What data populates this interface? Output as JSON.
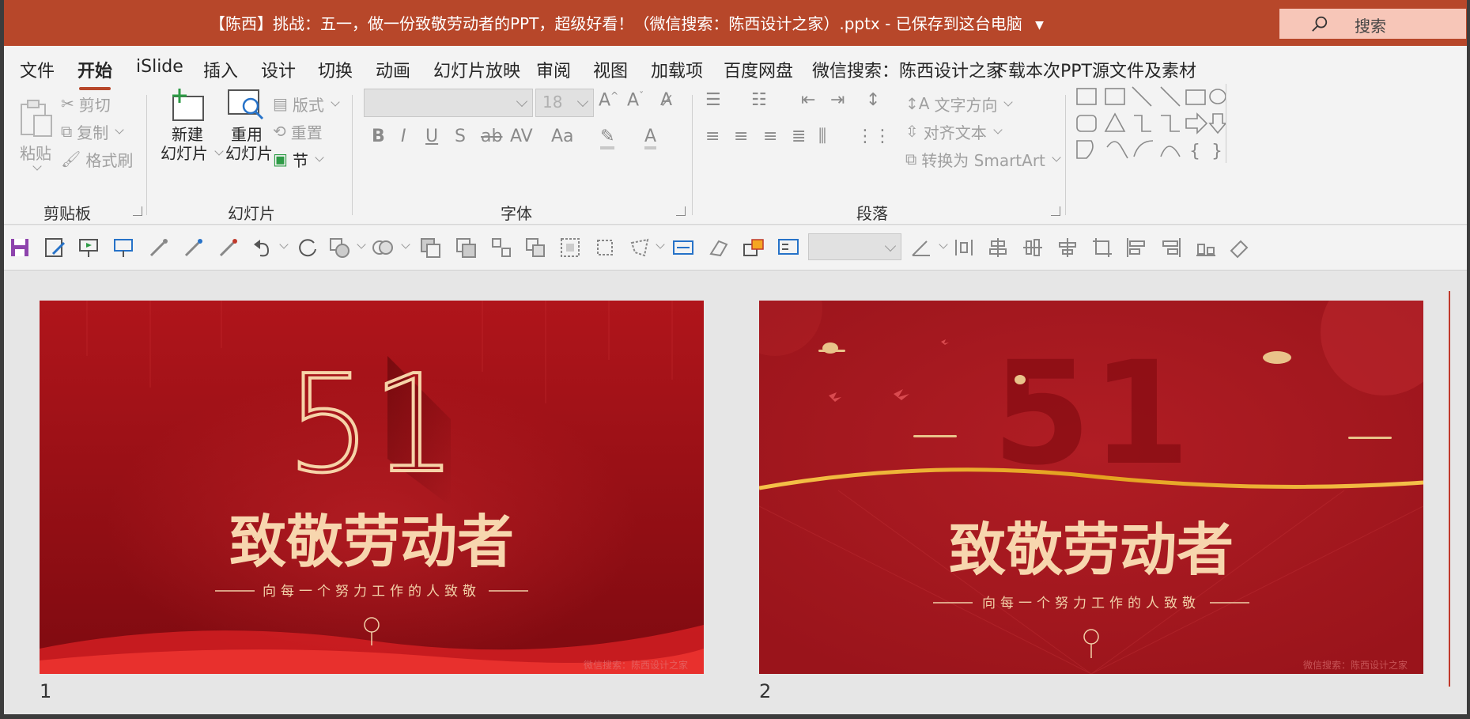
{
  "titlebar": {
    "title": "【陈西】挑战：五一，做一份致敬劳动者的PPT，超级好看！（微信搜索：陈西设计之家）.pptx  -  已保存到这台电脑",
    "search_label": "搜索"
  },
  "tabs": [
    "文件",
    "开始",
    "iSlide",
    "插入",
    "设计",
    "切换",
    "动画",
    "幻灯片放映",
    "审阅",
    "视图",
    "加载项",
    "百度网盘",
    "微信搜索：陈西设计之家",
    "下载本次PPT源文件及素材"
  ],
  "active_tab": "开始",
  "ribbon": {
    "clipboard": {
      "paste": "粘贴",
      "cut": "剪切",
      "copy": "复制",
      "format_painter": "格式刷",
      "label": "剪贴板"
    },
    "slides": {
      "new_slide_1": "新建",
      "new_slide_2": "幻灯片",
      "reuse_1": "重用",
      "reuse_2": "幻灯片",
      "layout": "版式",
      "reset": "重置",
      "section": "节",
      "label": "幻灯片"
    },
    "font": {
      "font_size": "18",
      "label": "字体"
    },
    "paragraph": {
      "text_direction": "文字方向",
      "align_text": "对齐文本",
      "smartart": "转换为 SmartArt",
      "label": "段落"
    }
  },
  "slides": [
    {
      "number": "1",
      "big_number": "51",
      "title": "致敬劳动者",
      "subtitle": "向每一个努力工作的人致敬",
      "watermark": "微信搜索：陈西设计之家"
    },
    {
      "number": "2",
      "big_number": "51",
      "title": "致敬劳动者",
      "subtitle": "向每一个努力工作的人致敬",
      "watermark": "微信搜索：陈西设计之家"
    }
  ],
  "colors": {
    "accent": "#b7472a",
    "slide_red": "#a8141c",
    "gold": "#f5d3a4"
  }
}
